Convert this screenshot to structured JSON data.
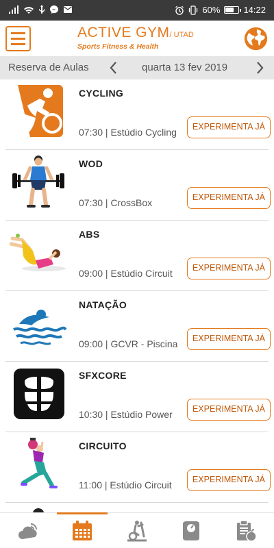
{
  "status_bar": {
    "battery": "60%",
    "time": "14:22"
  },
  "header": {
    "logo_title": "ACTIVE GYM",
    "logo_suffix": "/ UTAD",
    "logo_subtitle": "Sports  Fitness & Health",
    "accent": "#e47a1d"
  },
  "date_bar": {
    "section": "Reserva de Aulas",
    "date": "quarta 13 fev 2019"
  },
  "classes": [
    {
      "name": "CYCLING",
      "time": "07:30",
      "place": "Estúdio Cycling",
      "meta": "07:30 | Estúdio Cycling",
      "button": "EXPERIMENTA JÁ",
      "icon": "cycling-icon"
    },
    {
      "name": "WOD",
      "time": "07:30",
      "place": "CrossBox",
      "meta": "07:30 | CrossBox",
      "button": "EXPERIMENTA JÁ",
      "icon": "weightlifter-icon"
    },
    {
      "name": "ABS",
      "time": "09:00",
      "place": "Estúdio Circuit",
      "meta": "09:00 | Estúdio Circuit",
      "button": "EXPERIMENTA JÁ",
      "icon": "situps-icon"
    },
    {
      "name": "NATAÇÃO",
      "time": "09:00",
      "place": "GCVR - Piscina",
      "meta": "09:00 | GCVR - Piscina",
      "button": "EXPERIMENTA JÁ",
      "icon": "swimmer-icon"
    },
    {
      "name": "SFXCORE",
      "time": "10:30",
      "place": "Estúdio Power",
      "meta": "10:30 | Estúdio Power",
      "button": "EXPERIMENTA JÁ",
      "icon": "abs-core-icon"
    },
    {
      "name": "CIRCUITO",
      "time": "11:00",
      "place": "Estúdio Circuit",
      "meta": "11:00 | Estúdio Circuit",
      "button": "EXPERIMENTA JÁ",
      "icon": "kettlebell-icon"
    }
  ],
  "bottom_nav": [
    {
      "icon": "weather-cloud-icon",
      "active": false
    },
    {
      "icon": "calendar-icon",
      "active": true
    },
    {
      "icon": "elliptical-machine-icon",
      "active": false
    },
    {
      "icon": "scale-icon",
      "active": false
    },
    {
      "icon": "nutrition-clipboard-icon",
      "active": false
    }
  ]
}
